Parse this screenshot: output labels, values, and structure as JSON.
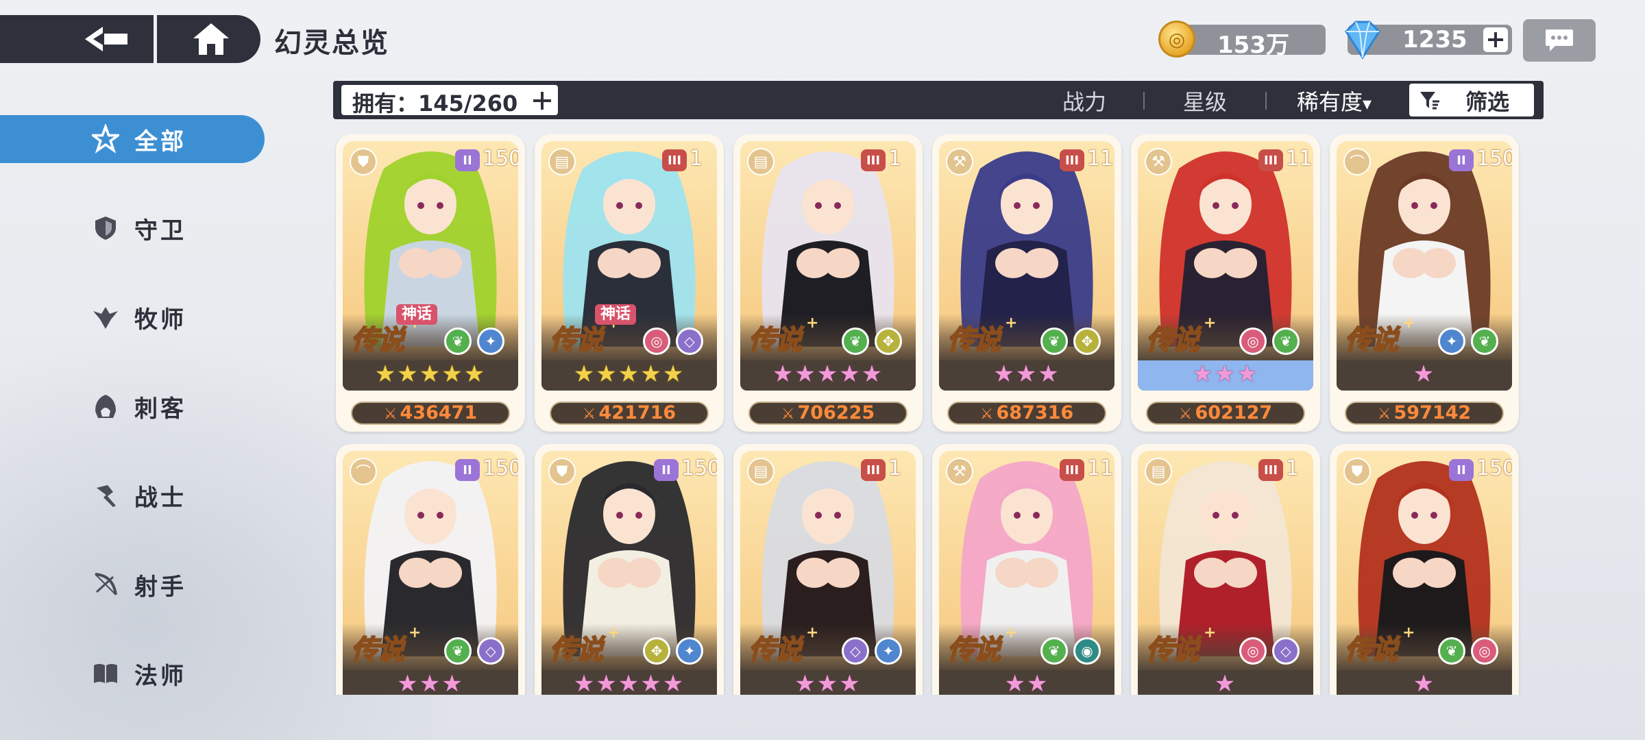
{
  "header": {
    "title": "幻灵总览",
    "gold": "153万",
    "gems": "1235"
  },
  "sidebar": {
    "items": [
      {
        "label": "全部",
        "icon": "all-star-icon",
        "active": true
      },
      {
        "label": "守卫",
        "icon": "shield-icon"
      },
      {
        "label": "牧师",
        "icon": "wings-icon"
      },
      {
        "label": "刺客",
        "icon": "hood-icon"
      },
      {
        "label": "战士",
        "icon": "hammer-icon"
      },
      {
        "label": "射手",
        "icon": "bow-icon"
      },
      {
        "label": "法师",
        "icon": "book-icon"
      }
    ]
  },
  "filter": {
    "owned_label": "拥有：145/260",
    "sort_power": "战力",
    "sort_star": "星级",
    "sort_rarity": "稀有度",
    "sort_rarity_arrow": "▾",
    "filter_label": "筛选"
  },
  "colors": {
    "accent": "#3d8fd4",
    "dark": "#2e303c",
    "power": "#ff8a3a",
    "tier_purple": "#9a74d6",
    "tier_red": "#c84e49"
  },
  "cards": [
    {
      "rarity": "传说",
      "mythic": "神话",
      "tier": "II",
      "tier_num": "150",
      "class_icon": "shield-icon",
      "stars": "★★★★★",
      "star_color": "gold",
      "power": "436471",
      "elements": [
        "leaf",
        "star"
      ]
    },
    {
      "rarity": "传说",
      "mythic": "神话",
      "tier": "III",
      "tier_num": "1",
      "class_icon": "book-icon",
      "stars": "★★★★★",
      "star_color": "gold",
      "power": "421716",
      "elements": [
        "swirl",
        "diamond"
      ]
    },
    {
      "rarity": "传说",
      "tier": "III",
      "tier_num": "1",
      "class_icon": "book-icon",
      "stars": "★★★★★",
      "star_color": "pink",
      "power": "706225",
      "elements": [
        "leaf",
        "wings"
      ]
    },
    {
      "rarity": "传说",
      "tier": "III",
      "tier_num": "11",
      "class_icon": "hammer-icon",
      "stars": "★★★",
      "star_color": "pink",
      "power": "687316",
      "elements": [
        "leaf",
        "wings"
      ]
    },
    {
      "rarity": "传说",
      "tier": "III",
      "tier_num": "11",
      "class_icon": "hammer-icon",
      "stars": "★★★",
      "star_color": "pink",
      "power": "602127",
      "elements": [
        "swirl",
        "leaf"
      ],
      "highlight": true
    },
    {
      "rarity": "传说",
      "tier": "II",
      "tier_num": "150",
      "class_icon": "bow-icon",
      "stars": "★",
      "star_color": "pink",
      "power": "597142",
      "elements": [
        "star",
        "leaf"
      ]
    },
    {
      "rarity": "传说",
      "tier": "II",
      "tier_num": "150",
      "class_icon": "bow-icon",
      "stars": "★★★",
      "star_color": "pink",
      "power": "",
      "elements": [
        "leaf",
        "diamond"
      ]
    },
    {
      "rarity": "传说",
      "tier": "II",
      "tier_num": "150",
      "class_icon": "shield-icon",
      "stars": "★★★★★",
      "star_color": "pink",
      "power": "",
      "elements": [
        "wings",
        "star"
      ]
    },
    {
      "rarity": "传说",
      "tier": "III",
      "tier_num": "1",
      "class_icon": "book-icon",
      "stars": "★★★",
      "star_color": "pink",
      "power": "",
      "elements": [
        "diamond",
        "star"
      ]
    },
    {
      "rarity": "传说",
      "tier": "III",
      "tier_num": "11",
      "class_icon": "hammer-icon",
      "stars": "★★",
      "star_color": "pink",
      "power": "",
      "elements": [
        "leaf",
        "eye"
      ]
    },
    {
      "rarity": "传说",
      "tier": "III",
      "tier_num": "1",
      "class_icon": "book-icon",
      "stars": "★",
      "star_color": "pink",
      "power": "",
      "elements": [
        "swirl",
        "diamond"
      ]
    },
    {
      "rarity": "传说",
      "tier": "II",
      "tier_num": "150",
      "class_icon": "shield-icon",
      "stars": "★",
      "star_color": "pink",
      "power": "",
      "elements": [
        "leaf",
        "swirl"
      ]
    }
  ]
}
